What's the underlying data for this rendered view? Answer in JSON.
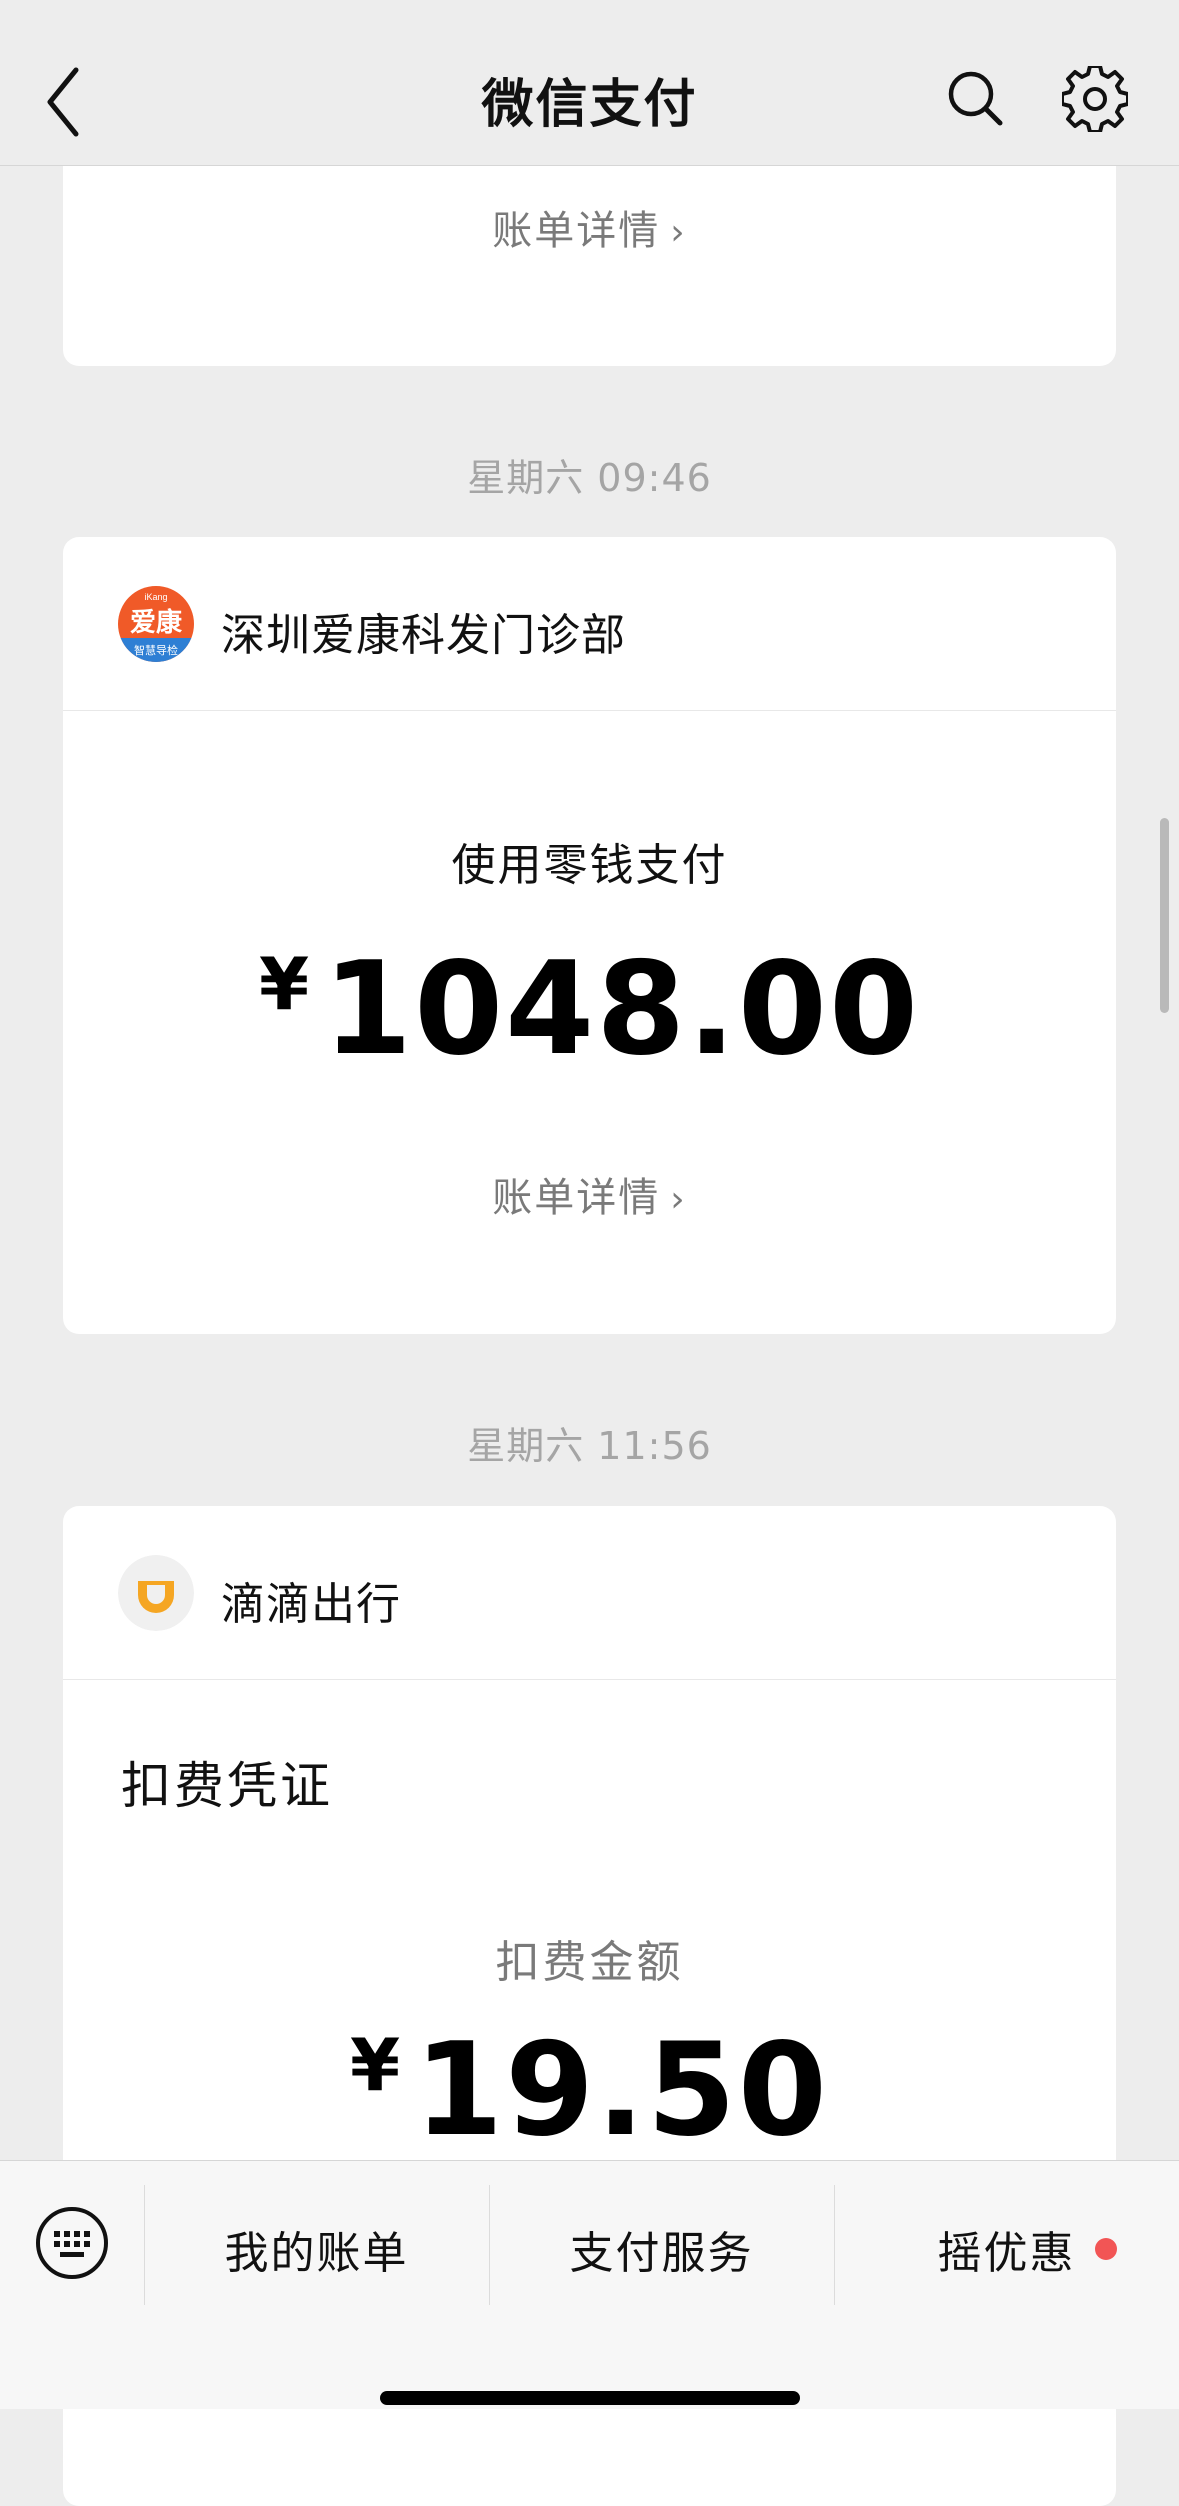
{
  "header": {
    "title": "微信支付"
  },
  "top_card": {
    "bill_link": "账单详情"
  },
  "clinic": {
    "timestamp": "星期六 09:46",
    "merchant_name": "深圳爱康科发门诊部",
    "logo_text": "爱康",
    "logo_top": "iKang",
    "logo_bottom": "智慧导检",
    "payment_method": "使用零钱支付",
    "currency": "¥",
    "amount": "1048.00",
    "bill_link": "账单详情"
  },
  "didi": {
    "timestamp": "星期六 11:56",
    "merchant_name": "滴滴出行",
    "voucher_title": "扣费凭证",
    "deduct_label": "扣费金额",
    "currency": "¥",
    "amount": "19.50"
  },
  "bottom_bar": {
    "tabs": [
      "我的账单",
      "支付服务",
      "摇优惠"
    ]
  },
  "colors": {
    "red_dot": "#f25555",
    "ikang_orange": "#f05a28",
    "ikang_blue": "#2e7fd4",
    "didi_orange": "#f5a623"
  }
}
